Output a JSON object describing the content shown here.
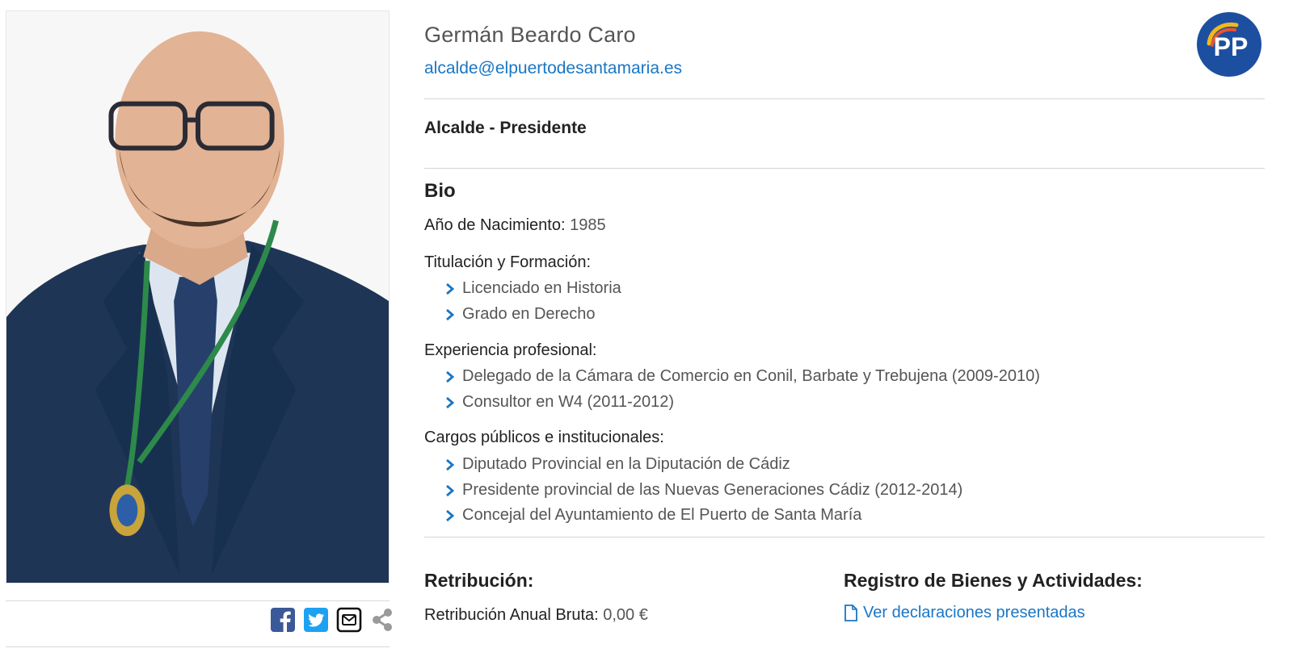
{
  "profile": {
    "name": "Germán Beardo Caro",
    "email": "alcalde@elpuertodesantamaria.es",
    "role": "Alcalde - Presidente",
    "party_logo_text": "PP"
  },
  "bio": {
    "heading": "Bio",
    "birth_label": "Año de Nacimiento:",
    "birth_value": "1985",
    "education": {
      "label": "Titulación y Formación:",
      "items": [
        "Licenciado en Historia",
        "Grado en Derecho"
      ]
    },
    "experience": {
      "label": "Experiencia profesional:",
      "items": [
        "Delegado de la Cámara de Comercio en Conil, Barbate y Trebujena (2009-2010)",
        "Consultor en W4 (2011-2012)"
      ]
    },
    "positions": {
      "label": "Cargos públicos e institucionales:",
      "items": [
        "Diputado Provincial en la Diputación de Cádiz",
        "Presidente provincial de las Nuevas Generaciones Cádiz (2012-2014)",
        "Concejal del Ayuntamiento de El Puerto de Santa María"
      ]
    }
  },
  "retribution": {
    "heading": "Retribución:",
    "label": "Retribución Anual Bruta:",
    "value": "0,00 €"
  },
  "registry": {
    "heading": "Registro de Bienes y Actividades:",
    "link": "Ver declaraciones presentadas"
  },
  "share": {
    "icons": [
      "facebook-icon",
      "twitter-icon",
      "email-icon",
      "share-icon"
    ]
  },
  "colors": {
    "link": "#1a76c4",
    "chevron": "#1a76c4",
    "facebook": "#3b5998",
    "twitter": "#1da1f2",
    "party_blue": "#1d4fa0",
    "jacket": "#1f3556"
  }
}
